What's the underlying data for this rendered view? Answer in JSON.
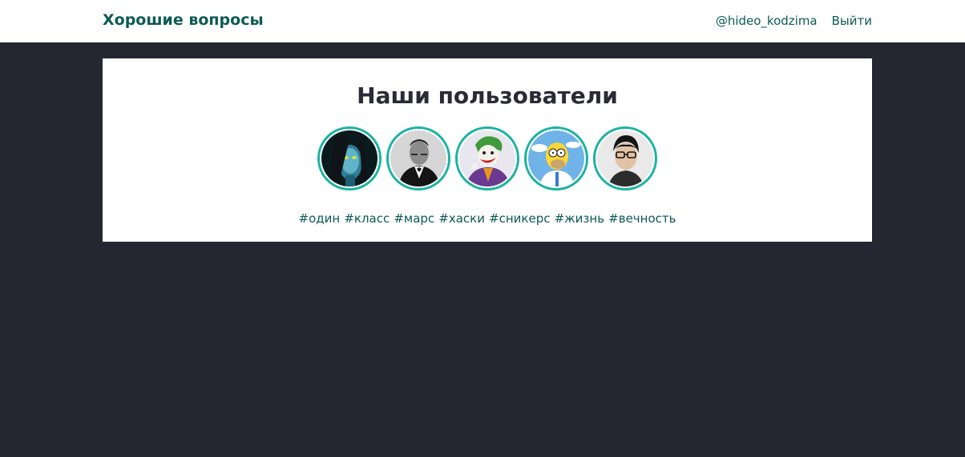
{
  "header": {
    "brand": "Хорошие вопросы",
    "username": "@hideo_kodzima",
    "logout": "Выйти"
  },
  "main": {
    "title": "Наши пользователи",
    "users": [
      {
        "name": "avatar-neytiri"
      },
      {
        "name": "avatar-bond"
      },
      {
        "name": "avatar-joker"
      },
      {
        "name": "avatar-homer"
      },
      {
        "name": "avatar-kojima"
      }
    ],
    "tags": [
      "#один",
      "#класс",
      "#марс",
      "#хаски",
      "#сникерс",
      "#жизнь",
      "#вечность"
    ]
  },
  "colors": {
    "accent": "#0d5a54",
    "avatar_border": "#1bb3a3",
    "background": "#252632"
  }
}
